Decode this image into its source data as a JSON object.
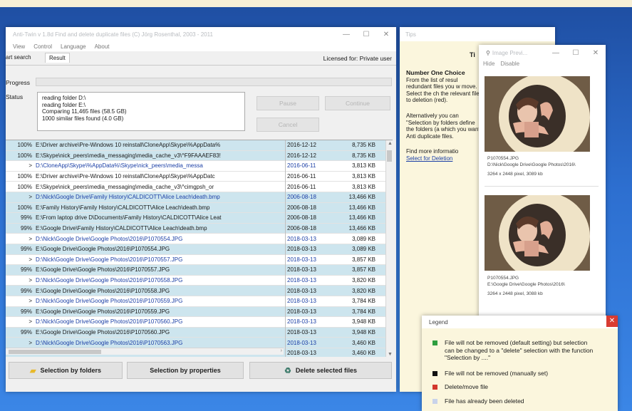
{
  "main": {
    "title": "Anti-Twin v 1.8d   Find and delete duplicate files   (C) Jörg Rosenthal, 2003 - 2011",
    "menu": [
      "View",
      "Control",
      "Language",
      "About"
    ],
    "tabs": [
      "art search",
      "Result"
    ],
    "licensed": "Licensed for: Private user",
    "progress_label": "Progress",
    "status_label": "Status",
    "status_lines": [
      "reading folder D:\\",
      "reading folder E:\\",
      "Comparing 11,465 files (58.5 GB)",
      "1000 similar files found (4.0 GB)"
    ],
    "pause": "Pause",
    "continue": "Continue",
    "cancel": "Cancel",
    "rows": [
      {
        "pct": "100%",
        "path": "E:\\Driver archive\\Pre-Windows 10 reinstall\\CloneApp\\Skype\\%AppData%",
        "date": "2016-12-12",
        "size": "8,735 KB"
      },
      {
        "pct": "100%",
        "path": "E:\\Skype\\nick_peers\\media_messaging\\media_cache_v3\\^F9FAAAEF83!",
        "date": "2016-12-12",
        "size": "8,735 KB"
      },
      {
        "pct": ">",
        "path": "D:\\CloneApp\\Skype\\%AppData%\\Skype\\nick_peers\\media_messa",
        "date": "2016-06-11",
        "size": "3,813 KB"
      },
      {
        "pct": "100%",
        "path": "E:\\Driver archive\\Pre-Windows 10 reinstall\\CloneApp\\Skype\\%AppDatc",
        "date": "2016-06-11",
        "size": "3,813 KB"
      },
      {
        "pct": "100%",
        "path": "E:\\Skype\\nick_peers\\media_messaging\\media_cache_v3\\^cimgpsh_or",
        "date": "2016-06-11",
        "size": "3,813 KB"
      },
      {
        "pct": ">",
        "path": "D:\\Nick\\Google Drive\\Family History\\CALDICOTT\\Alice Leach\\death.bmp",
        "date": "2006-08-18",
        "size": "13,466 KB"
      },
      {
        "pct": "100%",
        "path": "E:\\Family History\\Family History\\CALDICOTT\\Alice Leach\\death.bmp",
        "date": "2006-08-18",
        "size": "13,466 KB"
      },
      {
        "pct": "99%",
        "path": "E:\\From laptop drive D\\Documents\\Family History\\CALDICOTT\\Alice Leat",
        "date": "2006-08-18",
        "size": "13,466 KB"
      },
      {
        "pct": "99%",
        "path": "E:\\Google Drive\\Family History\\CALDICOTT\\Alice Leach\\death.bmp",
        "date": "2006-08-18",
        "size": "13,466 KB"
      },
      {
        "pct": ">",
        "path": "D:\\Nick\\Google Drive\\Google Photos\\2016\\P1070554.JPG",
        "date": "2018-03-13",
        "size": "3,089 KB"
      },
      {
        "pct": "99%",
        "path": "E:\\Google Drive\\Google Photos\\2016\\P1070554.JPG",
        "date": "2018-03-13",
        "size": "3,089 KB"
      },
      {
        "pct": ">",
        "path": "D:\\Nick\\Google Drive\\Google Photos\\2016\\P1070557.JPG",
        "date": "2018-03-13",
        "size": "3,857 KB"
      },
      {
        "pct": "99%",
        "path": "E:\\Google Drive\\Google Photos\\2016\\P1070557.JPG",
        "date": "2018-03-13",
        "size": "3,857 KB"
      },
      {
        "pct": ">",
        "path": "D:\\Nick\\Google Drive\\Google Photos\\2016\\P1070558.JPG",
        "date": "2018-03-13",
        "size": "3,820 KB"
      },
      {
        "pct": "99%",
        "path": "E:\\Google Drive\\Google Photos\\2016\\P1070558.JPG",
        "date": "2018-03-13",
        "size": "3,820 KB"
      },
      {
        "pct": ">",
        "path": "D:\\Nick\\Google Drive\\Google Photos\\2016\\P1070559.JPG",
        "date": "2018-03-13",
        "size": "3,784 KB"
      },
      {
        "pct": "99%",
        "path": "E:\\Google Drive\\Google Photos\\2016\\P1070559.JPG",
        "date": "2018-03-13",
        "size": "3,784 KB"
      },
      {
        "pct": ">",
        "path": "D:\\Nick\\Google Drive\\Google Photos\\2016\\P1070560.JPG",
        "date": "2018-03-13",
        "size": "3,948 KB"
      },
      {
        "pct": "99%",
        "path": "E:\\Google Drive\\Google Photos\\2016\\P1070560.JPG",
        "date": "2018-03-13",
        "size": "3,948 KB"
      },
      {
        "pct": ">",
        "path": "D:\\Nick\\Google Drive\\Google Photos\\2016\\P1070563.JPG",
        "date": "2018-03-13",
        "size": "3,460 KB"
      },
      {
        "pct": "",
        "path": "",
        "date": "2018-03-13",
        "size": "3,460 KB"
      }
    ],
    "btn_folders": "Selection by folders",
    "btn_properties": "Selection by properties",
    "btn_delete": "Delete selected files"
  },
  "tips": {
    "title": "Tips",
    "heading": "Ti",
    "bold": "Number One Choice",
    "para1": "From the list of resul redundant files you w move. Select the ch the relevant files to deletion (red).",
    "para2": "Alternatively you can \"Selection by folders define the folders (a which you want Anti duplicate files.",
    "para3": "Find more informatio",
    "link": "Select for Deletion"
  },
  "preview": {
    "title": "Image Previ...",
    "menu": [
      "Hide",
      "Disable"
    ],
    "img1": {
      "name": "P1070554.JPG",
      "path": "D:\\Nick\\Google Drive\\Google Photos\\2016\\",
      "dims": "3264 x 2448 pixel, 3089 kb"
    },
    "img2": {
      "name": "P1070554.JPG",
      "path": "E:\\Google Drive\\Google Photos\\2016\\",
      "dims": "3264 x 2448 pixel, 3088 kb"
    }
  },
  "legend": {
    "title": "Legend",
    "items": [
      {
        "color": "#2e9e3e",
        "text": "File will not be removed (default setting) but selection can be changed to a \"delete\" selection with the function \"Selection by ....\""
      },
      {
        "color": "#111111",
        "text": "File will not be removed (manually set)"
      },
      {
        "color": "#d3372d",
        "text": "Delete/move file"
      },
      {
        "color": "#c9d3ea",
        "text": "File has already been deleted"
      }
    ]
  }
}
